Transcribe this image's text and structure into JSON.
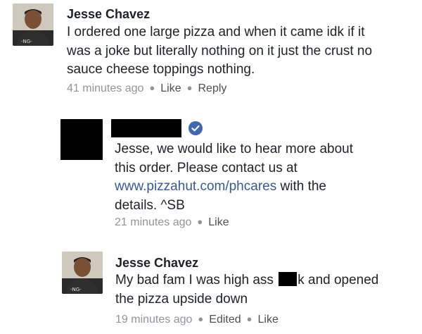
{
  "comments": [
    {
      "author": "Jesse Chavez",
      "lines": [
        "I ordered one large pizza and when it came idk if it",
        "was a joke but literally nothing on it just the crust no",
        "sauce cheese toppings nothing."
      ],
      "time": "41 minutes ago",
      "actions": [
        "Like",
        "Reply"
      ]
    },
    {
      "author": "",
      "verified": true,
      "lines": [
        "Jesse, we would like to hear more about",
        "this order. Please contact us at",
        "details. ^SB"
      ],
      "link_text": "www.pizzahut.com/phcares",
      "link_tail": " with the",
      "time": "21 minutes ago",
      "actions": [
        "Like"
      ]
    },
    {
      "author": "Jesse Chavez",
      "line1_before": "My bad fam I was high ass ",
      "line1_after": "k and opened",
      "line2": "the pizza upside down",
      "time": "19 minutes ago",
      "edited": "Edited",
      "actions": [
        "Like"
      ]
    }
  ],
  "colors": {
    "text": "#1d2129",
    "meta": "#90949c",
    "link": "#365899",
    "verified": "#4267b2"
  }
}
